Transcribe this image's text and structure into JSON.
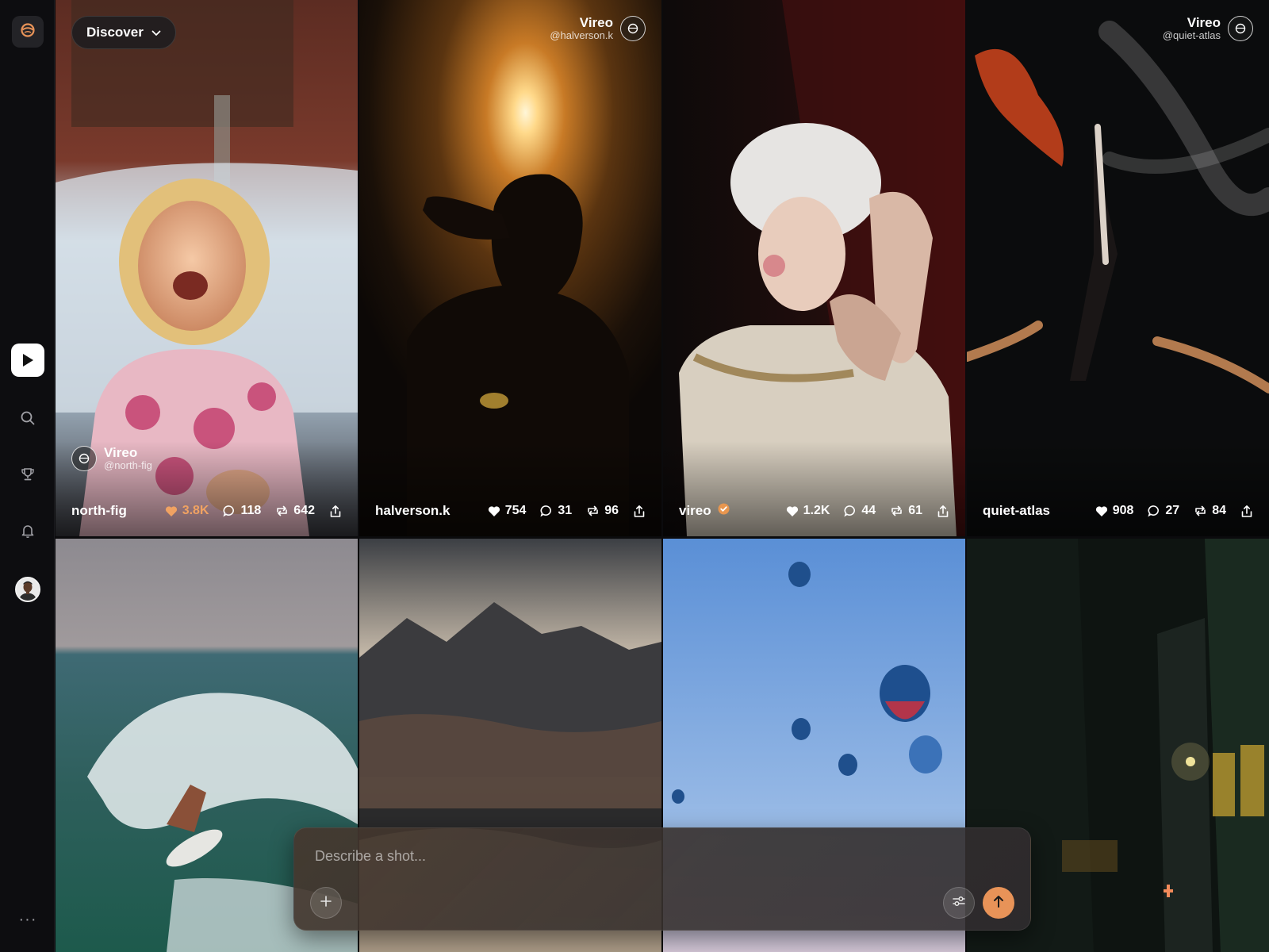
{
  "sidebar": {
    "logo_icon": "app-logo-icon",
    "items": [
      {
        "name": "play",
        "icon": "play-icon",
        "active": true
      },
      {
        "name": "search",
        "icon": "search-icon"
      },
      {
        "name": "trophy",
        "icon": "trophy-icon"
      },
      {
        "name": "notifications",
        "icon": "bell-icon"
      }
    ],
    "more_label": "···"
  },
  "header": {
    "discover_label": "Discover"
  },
  "tiles": [
    {
      "user": "north-fig",
      "watermark": {
        "brand": "Vireo",
        "handle": "@north-fig",
        "position": "bottom-left"
      },
      "likes": "3.8K",
      "liked": true,
      "comments": "118",
      "reposts": "642"
    },
    {
      "user": "halverson.k",
      "watermark": {
        "brand": "Vireo",
        "handle": "@halverson.k",
        "position": "top-right"
      },
      "likes": "754",
      "comments": "31",
      "reposts": "96"
    },
    {
      "user": "vireo",
      "verified": true,
      "likes": "1.2K",
      "comments": "44",
      "reposts": "61"
    },
    {
      "user": "quiet-atlas",
      "watermark": {
        "brand": "Vireo",
        "handle": "@quiet-atlas",
        "position": "top-right"
      },
      "likes": "908",
      "comments": "27",
      "reposts": "84"
    }
  ],
  "composer": {
    "placeholder": "Describe a shot..."
  },
  "colors": {
    "accent": "#e89358",
    "liked": "#f0a262",
    "verified": "#e8964f"
  }
}
